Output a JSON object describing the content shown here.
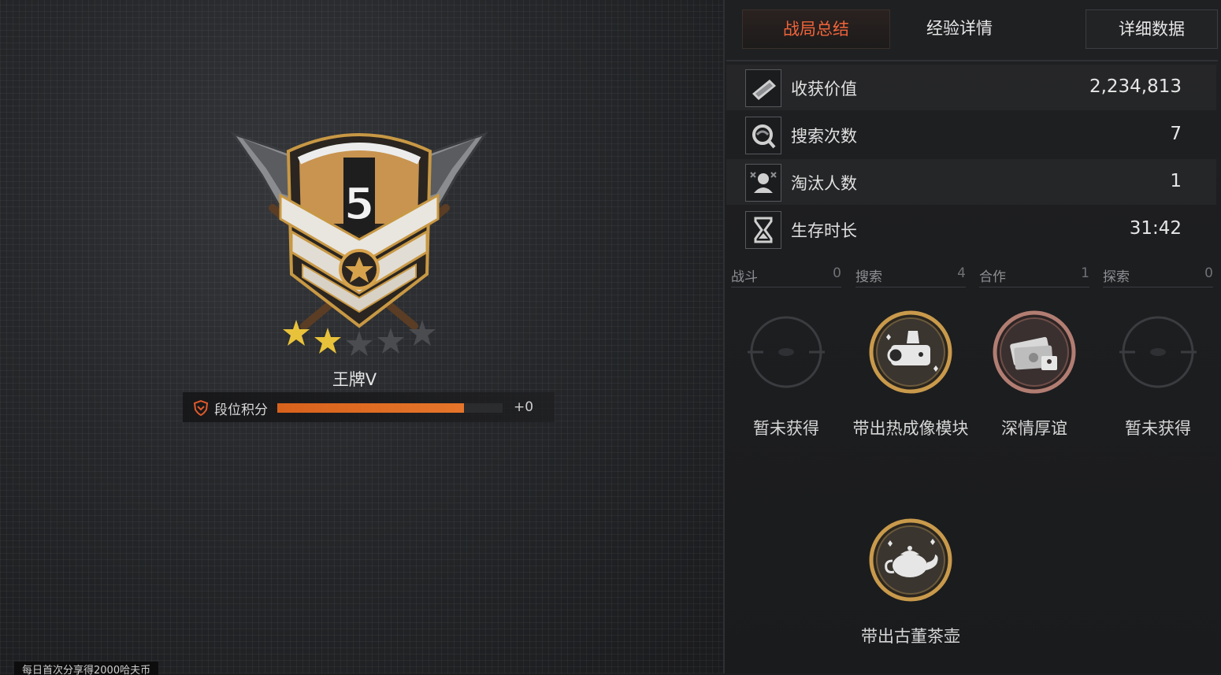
{
  "tabs": {
    "summary": "战局总结",
    "experience": "经验详情",
    "detail": "详细数据"
  },
  "stats": [
    {
      "icon": "cash-icon",
      "label": "收获价值",
      "value": "2,234,813"
    },
    {
      "icon": "search-icon",
      "label": "搜索次数",
      "value": "7"
    },
    {
      "icon": "eliminate-icon",
      "label": "淘汰人数",
      "value": "1"
    },
    {
      "icon": "hourglass-icon",
      "label": "生存时长",
      "value": "31:42"
    }
  ],
  "categories": [
    {
      "name": "战斗",
      "count": "0"
    },
    {
      "name": "搜索",
      "count": "4"
    },
    {
      "name": "合作",
      "count": "1"
    },
    {
      "name": "探索",
      "count": "0"
    }
  ],
  "achievements": [
    {
      "label": "暂未获得",
      "icon": "empty-achievement-icon"
    },
    {
      "label": "带出热成像模块",
      "icon": "thermal-module-icon"
    },
    {
      "label": "深情厚谊",
      "icon": "cash-stack-icon"
    },
    {
      "label": "暂未获得",
      "icon": "empty-achievement-icon"
    },
    {
      "label": "带出古董茶壶",
      "icon": "teapot-icon"
    }
  ],
  "rank": {
    "name": "王牌V",
    "tier_number": "5",
    "stars_filled": 2,
    "stars_total": 5,
    "points_label": "段位积分",
    "points_delta": "+0",
    "progress_fraction": 0.83,
    "accent_color": "#e06a24"
  },
  "bottom_note": "每日首次分享得2000哈夫币"
}
